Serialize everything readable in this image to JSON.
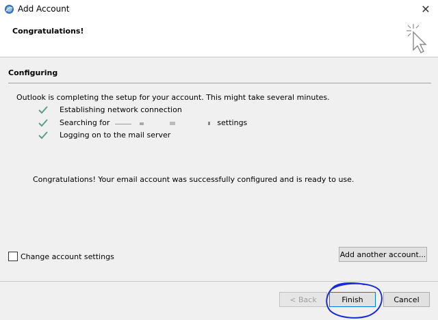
{
  "window": {
    "title": "Add Account",
    "close_glyph": "✕"
  },
  "banner": {
    "title": "Congratulations!"
  },
  "section": {
    "title": "Configuring"
  },
  "intro": "Outlook is completing the setup for your account. This might take several minutes.",
  "steps": [
    {
      "before": "Establishing network connection",
      "after": "",
      "status": "done"
    },
    {
      "before": "Searching for ",
      "after": " settings",
      "status": "done"
    },
    {
      "before": "Logging on to the mail server",
      "after": "",
      "status": "done"
    }
  ],
  "success_message": "Congratulations! Your email account was successfully configured and is ready to use.",
  "options": {
    "change_settings_label": "Change account settings",
    "change_settings_checked": false
  },
  "buttons": {
    "add_another": "Add another account...",
    "back": "< Back",
    "finish": "Finish",
    "cancel": "Cancel"
  },
  "colors": {
    "check": "#5a9e8a",
    "scribble": "#1a2bd6"
  }
}
